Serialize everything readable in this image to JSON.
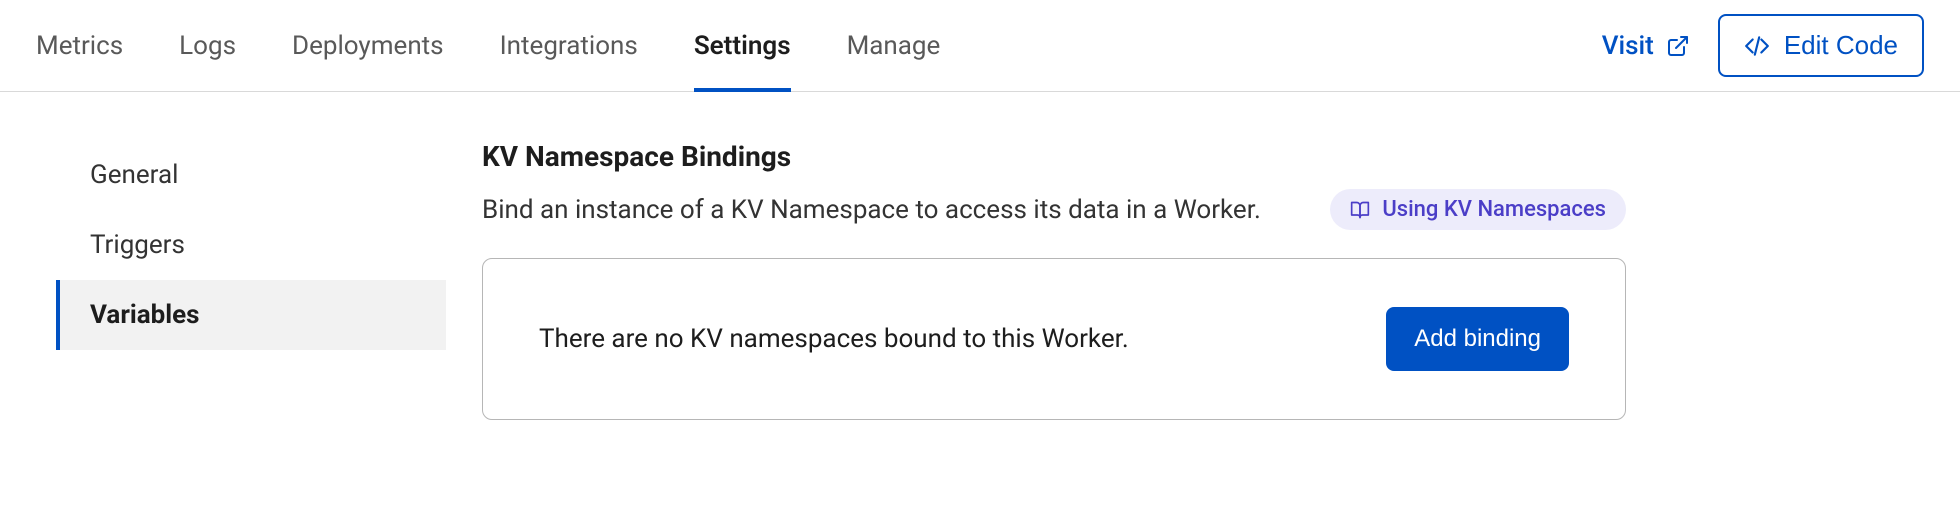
{
  "topbar": {
    "tabs": [
      {
        "label": "Metrics",
        "active": false
      },
      {
        "label": "Logs",
        "active": false
      },
      {
        "label": "Deployments",
        "active": false
      },
      {
        "label": "Integrations",
        "active": false
      },
      {
        "label": "Settings",
        "active": true
      },
      {
        "label": "Manage",
        "active": false
      }
    ],
    "visit_label": "Visit",
    "edit_code_label": "Edit Code"
  },
  "sidebar": {
    "items": [
      {
        "label": "General",
        "active": false
      },
      {
        "label": "Triggers",
        "active": false
      },
      {
        "label": "Variables",
        "active": true
      }
    ]
  },
  "section": {
    "title": "KV Namespace Bindings",
    "description": "Bind an instance of a KV Namespace to access its data in a Worker.",
    "doc_link_label": "Using KV Namespaces",
    "empty_message": "There are no KV namespaces bound to this Worker.",
    "add_button_label": "Add binding"
  }
}
